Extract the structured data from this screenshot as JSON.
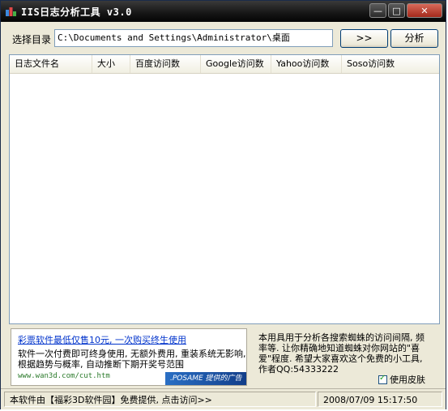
{
  "window": {
    "title": "IIS日志分析工具 v3.0",
    "controls": {
      "minimize": "—",
      "maximize": "□",
      "close": "✕"
    }
  },
  "toolbar": {
    "dir_label": "选择目录",
    "dir_value": "C:\\Documents and Settings\\Administrator\\桌面",
    "browse_label": ">>",
    "analyze_label": "分析"
  },
  "table": {
    "columns": [
      "日志文件名",
      "大小",
      "百度访问数",
      "Google访问数",
      "Yahoo访问数",
      "Soso访问数"
    ],
    "rows": []
  },
  "ad": {
    "title": "彩票软件最低仅售10元, 一次购买终生使用",
    "body": "软件一次付费即可终身使用, 无额外费用, 重装系统无影响, 根据趋势与概率, 自动推断下期开奖号范围",
    "url": "www.wan3d.com/cut.htm",
    "tag": ".POSAME 提供的广告"
  },
  "description": "本用具用于分析各搜索蜘蛛的访问间隔, 频率等. 让你精确地知道蜘蛛对你网站的\"喜爱\"程度. 希望大家喜欢这个免费的小工具, 作者QQ:54333222",
  "skin_label": "使用皮肤",
  "status": {
    "link": "本软件由【福彩3D软件园】免费提供, 点击访问>>",
    "datetime": "2008/07/09  15:17:50"
  },
  "colors": {
    "titlebar": "#151515",
    "frame": "#ece9d8",
    "link": "#0033cc"
  }
}
